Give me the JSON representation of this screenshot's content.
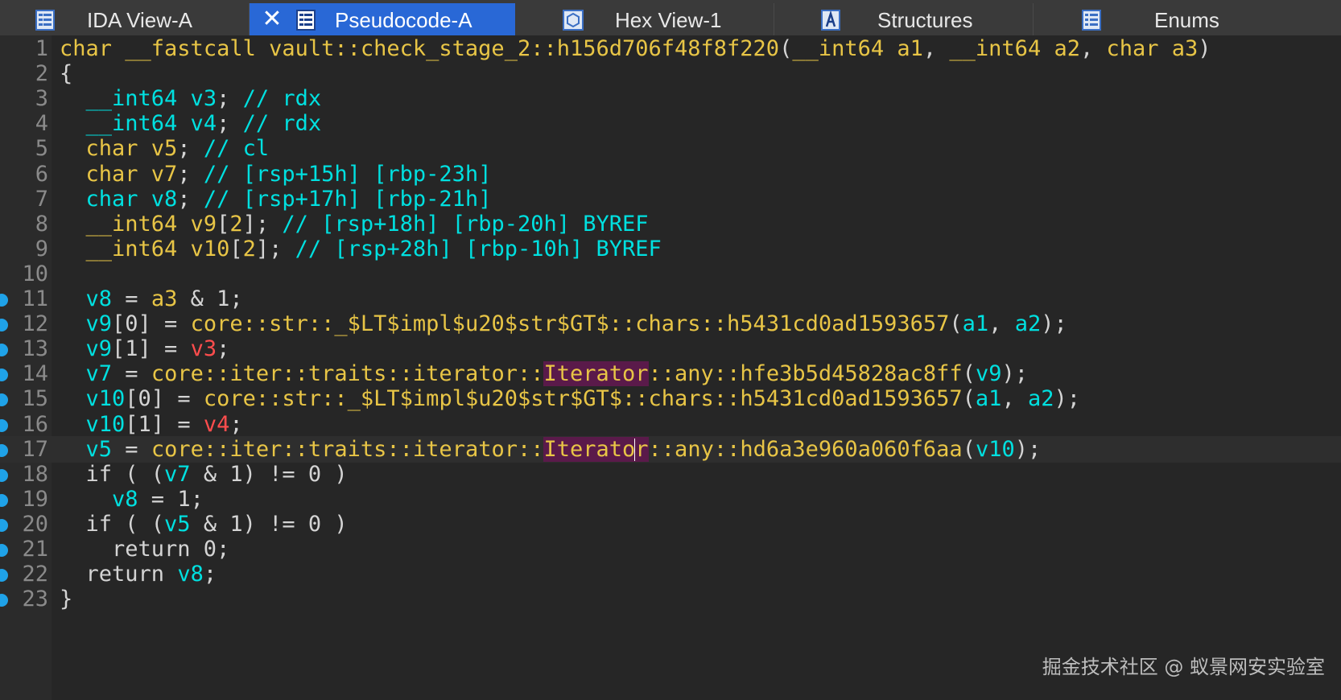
{
  "tabs": [
    {
      "label": "IDA View-A",
      "icon": "ida-view-icon",
      "active": false
    },
    {
      "label": "Pseudocode-A",
      "icon": "pseudocode-icon",
      "active": true,
      "closable": true
    },
    {
      "label": "Hex View-1",
      "icon": "hex-view-icon",
      "active": false
    },
    {
      "label": "Structures",
      "icon": "structures-icon",
      "active": false
    },
    {
      "label": "Enums",
      "icon": "enums-icon",
      "active": false
    }
  ],
  "colors": {
    "accent_tab": "#2968d6",
    "keyword": "#e8c546",
    "variable": "#00e0e0",
    "register_value": "#ff4d4d",
    "breakpoint": "#1fa2e8",
    "highlight_bg": "#5a1a4a"
  },
  "code": {
    "current_line": 17,
    "lines": [
      {
        "no": "1",
        "bp": false,
        "tokens": [
          [
            "kw",
            "char "
          ],
          [
            "kw",
            "__fastcall "
          ],
          [
            "kw",
            "vault::check_stage_2::h156d706f48f8f220"
          ],
          [
            "plain",
            "("
          ],
          [
            "kw",
            "__int64 "
          ],
          [
            "kw",
            "a1"
          ],
          [
            "plain",
            ", "
          ],
          [
            "kw",
            "__int64 "
          ],
          [
            "kw",
            "a2"
          ],
          [
            "plain",
            ", "
          ],
          [
            "kw",
            "char "
          ],
          [
            "kw",
            "a3"
          ],
          [
            "plain",
            ")"
          ]
        ]
      },
      {
        "no": "2",
        "bp": false,
        "tokens": [
          [
            "plain",
            "{"
          ]
        ]
      },
      {
        "no": "3",
        "bp": false,
        "tokens": [
          [
            "plain",
            "  "
          ],
          [
            "var",
            "__int64 v3"
          ],
          [
            "plain",
            "; "
          ],
          [
            "var",
            "// rdx"
          ]
        ]
      },
      {
        "no": "4",
        "bp": false,
        "tokens": [
          [
            "plain",
            "  "
          ],
          [
            "var",
            "__int64 v4"
          ],
          [
            "plain",
            "; "
          ],
          [
            "var",
            "// rdx"
          ]
        ]
      },
      {
        "no": "5",
        "bp": false,
        "tokens": [
          [
            "plain",
            "  "
          ],
          [
            "kw",
            "char v5"
          ],
          [
            "plain",
            "; "
          ],
          [
            "var",
            "// cl"
          ]
        ]
      },
      {
        "no": "6",
        "bp": false,
        "tokens": [
          [
            "plain",
            "  "
          ],
          [
            "kw",
            "char v7"
          ],
          [
            "plain",
            "; "
          ],
          [
            "var",
            "// [rsp+15h] [rbp-23h]"
          ]
        ]
      },
      {
        "no": "7",
        "bp": false,
        "tokens": [
          [
            "plain",
            "  "
          ],
          [
            "var",
            "char v8"
          ],
          [
            "plain",
            "; "
          ],
          [
            "var",
            "// [rsp+17h] [rbp-21h]"
          ]
        ]
      },
      {
        "no": "8",
        "bp": false,
        "tokens": [
          [
            "plain",
            "  "
          ],
          [
            "kw",
            "__int64 v9"
          ],
          [
            "plain",
            "["
          ],
          [
            "idx",
            "2"
          ],
          [
            "plain",
            "]; "
          ],
          [
            "var",
            "// [rsp+18h] [rbp-20h] BYREF"
          ]
        ]
      },
      {
        "no": "9",
        "bp": false,
        "tokens": [
          [
            "plain",
            "  "
          ],
          [
            "kw",
            "__int64 v10"
          ],
          [
            "plain",
            "["
          ],
          [
            "idx",
            "2"
          ],
          [
            "plain",
            "]; "
          ],
          [
            "var",
            "// [rsp+28h] [rbp-10h] BYREF"
          ]
        ]
      },
      {
        "no": "10",
        "bp": false,
        "tokens": []
      },
      {
        "no": "11",
        "bp": true,
        "tokens": [
          [
            "plain",
            "  "
          ],
          [
            "var",
            "v8"
          ],
          [
            "plain",
            " = "
          ],
          [
            "kw",
            "a3"
          ],
          [
            "plain",
            " & 1;"
          ]
        ]
      },
      {
        "no": "12",
        "bp": true,
        "tokens": [
          [
            "plain",
            "  "
          ],
          [
            "var",
            "v9"
          ],
          [
            "plain",
            "[0] = "
          ],
          [
            "kw",
            "core::str::_$LT$impl$u20$str$GT$::chars::h5431cd0ad1593657"
          ],
          [
            "plain",
            "("
          ],
          [
            "var",
            "a1"
          ],
          [
            "plain",
            ", "
          ],
          [
            "var",
            "a2"
          ],
          [
            "plain",
            ");"
          ]
        ]
      },
      {
        "no": "13",
        "bp": true,
        "tokens": [
          [
            "plain",
            "  "
          ],
          [
            "var",
            "v9"
          ],
          [
            "plain",
            "[1] = "
          ],
          [
            "red",
            "v3"
          ],
          [
            "plain",
            ";"
          ]
        ]
      },
      {
        "no": "14",
        "bp": true,
        "tokens": [
          [
            "plain",
            "  "
          ],
          [
            "var",
            "v7"
          ],
          [
            "plain",
            " = "
          ],
          [
            "kw",
            "core::iter::traits::iterator::"
          ],
          [
            "hl",
            "Iterator"
          ],
          [
            "kw",
            "::any::hfe3b5d45828ac8ff"
          ],
          [
            "plain",
            "("
          ],
          [
            "var",
            "v9"
          ],
          [
            "plain",
            ");"
          ]
        ]
      },
      {
        "no": "15",
        "bp": true,
        "tokens": [
          [
            "plain",
            "  "
          ],
          [
            "var",
            "v10"
          ],
          [
            "plain",
            "[0] = "
          ],
          [
            "kw",
            "core::str::_$LT$impl$u20$str$GT$::chars::h5431cd0ad1593657"
          ],
          [
            "plain",
            "("
          ],
          [
            "var",
            "a1"
          ],
          [
            "plain",
            ", "
          ],
          [
            "var",
            "a2"
          ],
          [
            "plain",
            ");"
          ]
        ]
      },
      {
        "no": "16",
        "bp": true,
        "tokens": [
          [
            "plain",
            "  "
          ],
          [
            "var",
            "v10"
          ],
          [
            "plain",
            "[1] = "
          ],
          [
            "red",
            "v4"
          ],
          [
            "plain",
            ";"
          ]
        ]
      },
      {
        "no": "17",
        "bp": true,
        "tokens": [
          [
            "plain",
            "  "
          ],
          [
            "var",
            "v5"
          ],
          [
            "plain",
            " = "
          ],
          [
            "kw",
            "core::iter::traits::iterator::"
          ],
          [
            "hl",
            "Iterato"
          ],
          [
            "cursor",
            ""
          ],
          [
            "hl",
            "r"
          ],
          [
            "kw",
            "::any::hd6a3e960a060f6aa"
          ],
          [
            "plain",
            "("
          ],
          [
            "var",
            "v10"
          ],
          [
            "plain",
            ");"
          ]
        ]
      },
      {
        "no": "18",
        "bp": true,
        "tokens": [
          [
            "plain",
            "  if ( ("
          ],
          [
            "var",
            "v7"
          ],
          [
            "plain",
            " & 1) != 0 )"
          ]
        ]
      },
      {
        "no": "19",
        "bp": true,
        "tokens": [
          [
            "plain",
            "    "
          ],
          [
            "var",
            "v8"
          ],
          [
            "plain",
            " = 1;"
          ]
        ]
      },
      {
        "no": "20",
        "bp": true,
        "tokens": [
          [
            "plain",
            "  if ( ("
          ],
          [
            "var",
            "v5"
          ],
          [
            "plain",
            " & 1) != 0 )"
          ]
        ]
      },
      {
        "no": "21",
        "bp": true,
        "tokens": [
          [
            "plain",
            "    return 0;"
          ]
        ]
      },
      {
        "no": "22",
        "bp": true,
        "tokens": [
          [
            "plain",
            "  return "
          ],
          [
            "var",
            "v8"
          ],
          [
            "plain",
            ";"
          ]
        ]
      },
      {
        "no": "23",
        "bp": true,
        "tokens": [
          [
            "plain",
            "}"
          ]
        ]
      }
    ]
  },
  "watermark": "掘金技术社区 @ 蚁景网安实验室"
}
